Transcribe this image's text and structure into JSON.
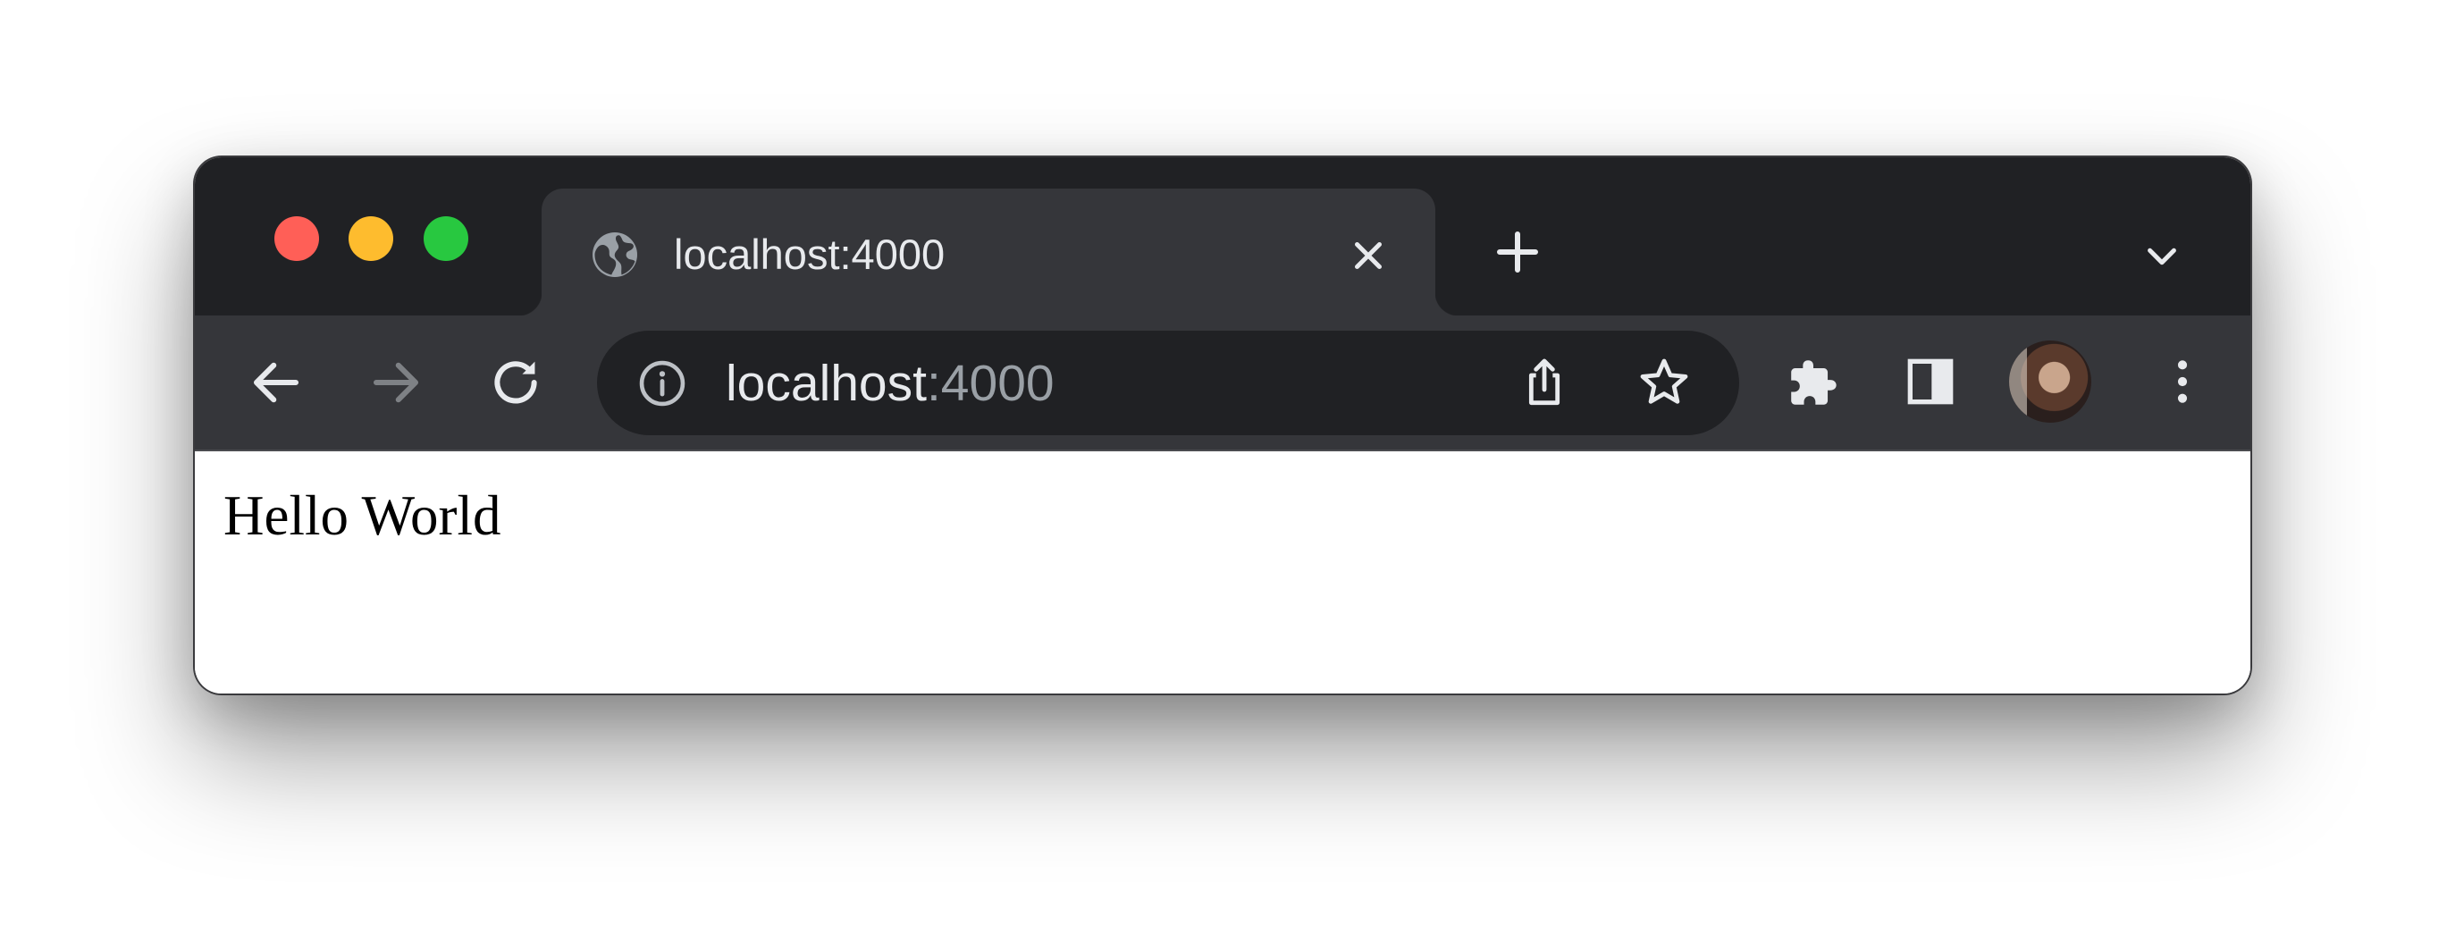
{
  "window": {
    "traffic_lights": {
      "close_color": "#ff5f57",
      "minimize_color": "#febc2e",
      "maximize_color": "#28c840"
    }
  },
  "tab": {
    "favicon_icon": "globe-icon",
    "title": "localhost:4000",
    "close_icon": "close-icon"
  },
  "tabstrip": {
    "new_tab_icon": "plus-icon",
    "tab_search_icon": "chevron-down-icon"
  },
  "toolbar": {
    "back_icon": "arrow-left-icon",
    "forward_icon": "arrow-right-icon",
    "reload_icon": "reload-icon",
    "extensions_icon": "puzzle-icon",
    "side_panel_icon": "side-panel-icon",
    "menu_icon": "more-vert-icon"
  },
  "omnibox": {
    "info_icon": "info-icon",
    "host": "localhost",
    "port": ":4000",
    "share_icon": "share-icon",
    "bookmark_icon": "star-icon"
  },
  "page": {
    "text": "Hello World"
  },
  "colors": {
    "tabstrip_bg": "#202124",
    "toolbar_bg": "#35363a",
    "omnibox_bg": "#202124",
    "text_primary": "#e8eaed",
    "text_muted": "#9aa0a6"
  }
}
